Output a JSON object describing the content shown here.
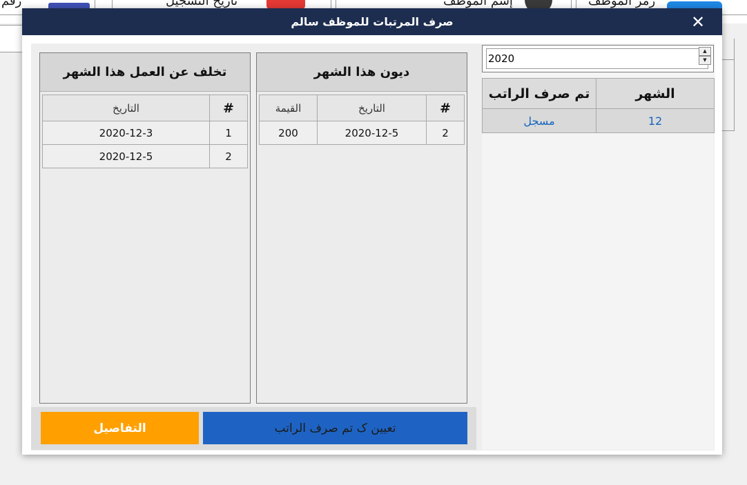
{
  "background": {
    "label_employee_number": "رقم",
    "label_registration_date": "تاريخ التسجيل",
    "label_employee_name": "إسم الموظف",
    "label_employee_code": "رمز الموظف"
  },
  "dialog": {
    "title": "صرف المرتبات للموظف سالم",
    "close_symbol": "✕"
  },
  "year_selector": {
    "value": "2020",
    "up": "▲",
    "down": "▼"
  },
  "months_table": {
    "headers": {
      "month": "الشهر",
      "salary_paid": "تم صرف الراتب"
    },
    "rows": [
      {
        "month": "12",
        "status": "مسجل"
      }
    ]
  },
  "debts_panel": {
    "title": "ديون هذا الشهر",
    "headers": {
      "index": "#",
      "date": "التاريخ",
      "value": "القيمة"
    },
    "rows": [
      {
        "index": "2",
        "date": "2020-12-5",
        "value": "200"
      }
    ]
  },
  "absence_panel": {
    "title": "تخلف عن العمل هذا الشهر",
    "headers": {
      "index": "#",
      "date": "التاريخ"
    },
    "rows": [
      {
        "index": "1",
        "date": "2020-12-3"
      },
      {
        "index": "2",
        "date": "2020-12-5"
      }
    ]
  },
  "actions": {
    "assign_label": "تعيين ک تم صرف الراتب",
    "details_label": "التفاصيل"
  },
  "colors": {
    "titlebar": "#1d2d4f",
    "assign_button": "#1e63c3",
    "details_button": "#ffa000",
    "month_link": "#1565c0"
  }
}
